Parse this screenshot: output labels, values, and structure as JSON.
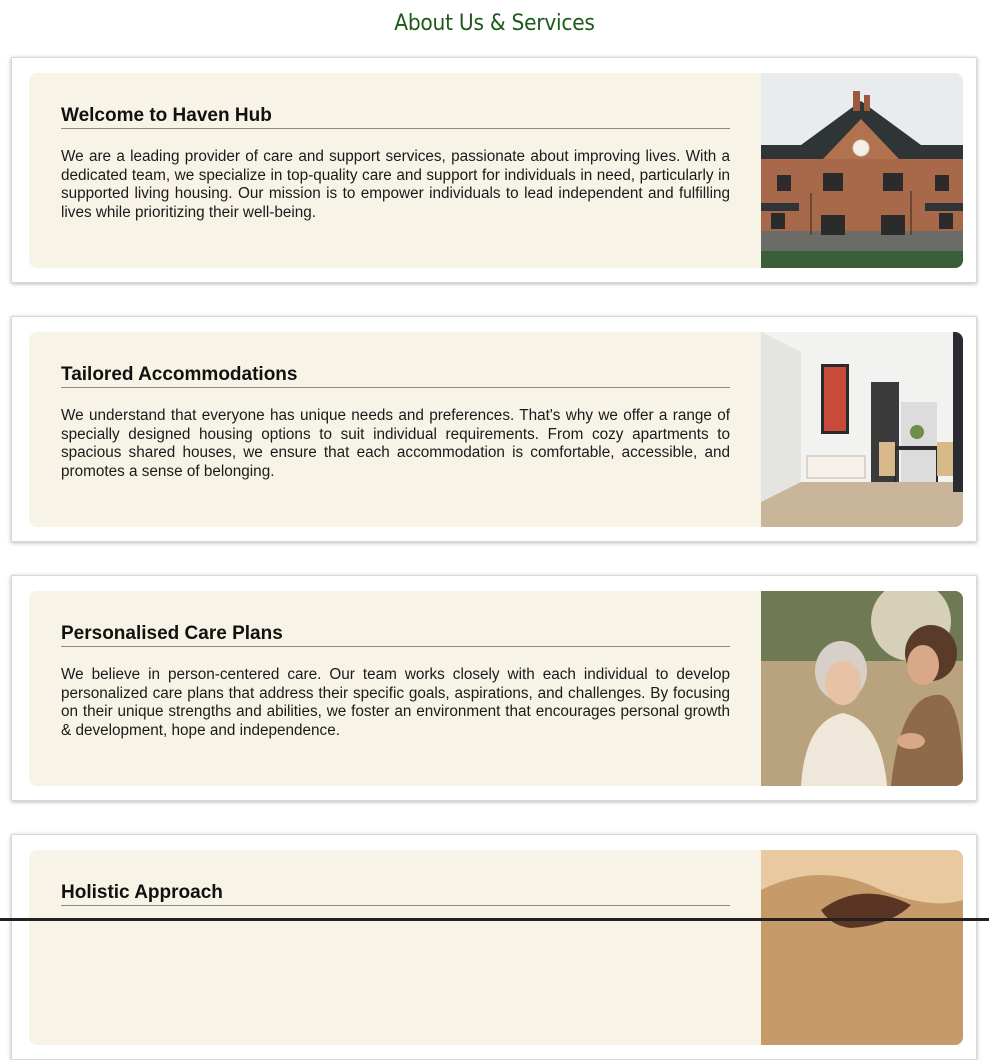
{
  "page": {
    "title": "About Us & Services"
  },
  "sections": [
    {
      "heading": "Welcome to Haven Hub",
      "body": "We are a leading provider of care and support services, passionate about improving lives. With a dedicated team, we specialize in top-quality care and support for individuals in need, particularly in supported living housing. Our mission is to empower individuals to lead independent and fulfilling lives while prioritizing their well-being.",
      "image": "brick-house-photo"
    },
    {
      "heading": "Tailored Accommodations",
      "body": "We understand that everyone has unique needs and preferences. That's why we offer a range of specially designed housing options to suit individual requirements. From cozy apartments to spacious shared houses, we ensure that each accommodation is comfortable, accessible, and promotes a sense of belonging.",
      "image": "apartment-interior-photo"
    },
    {
      "heading": "Personalised Care Plans",
      "body": "We believe in person-centered care. Our team works closely with each individual to develop personalized care plans that address their specific goals, aspirations, and challenges. By focusing on their unique strengths and abilities, we foster an environment that encourages personal growth & development, hope and independence.",
      "image": "caregiver-with-elderly-woman-photo"
    },
    {
      "heading": "Holistic Approach",
      "body": "",
      "image": "hands-massage-photo"
    }
  ],
  "colors": {
    "title": "#1e5a1a",
    "card_background": "#f7f3e6",
    "divider": "#8a8a8a"
  }
}
